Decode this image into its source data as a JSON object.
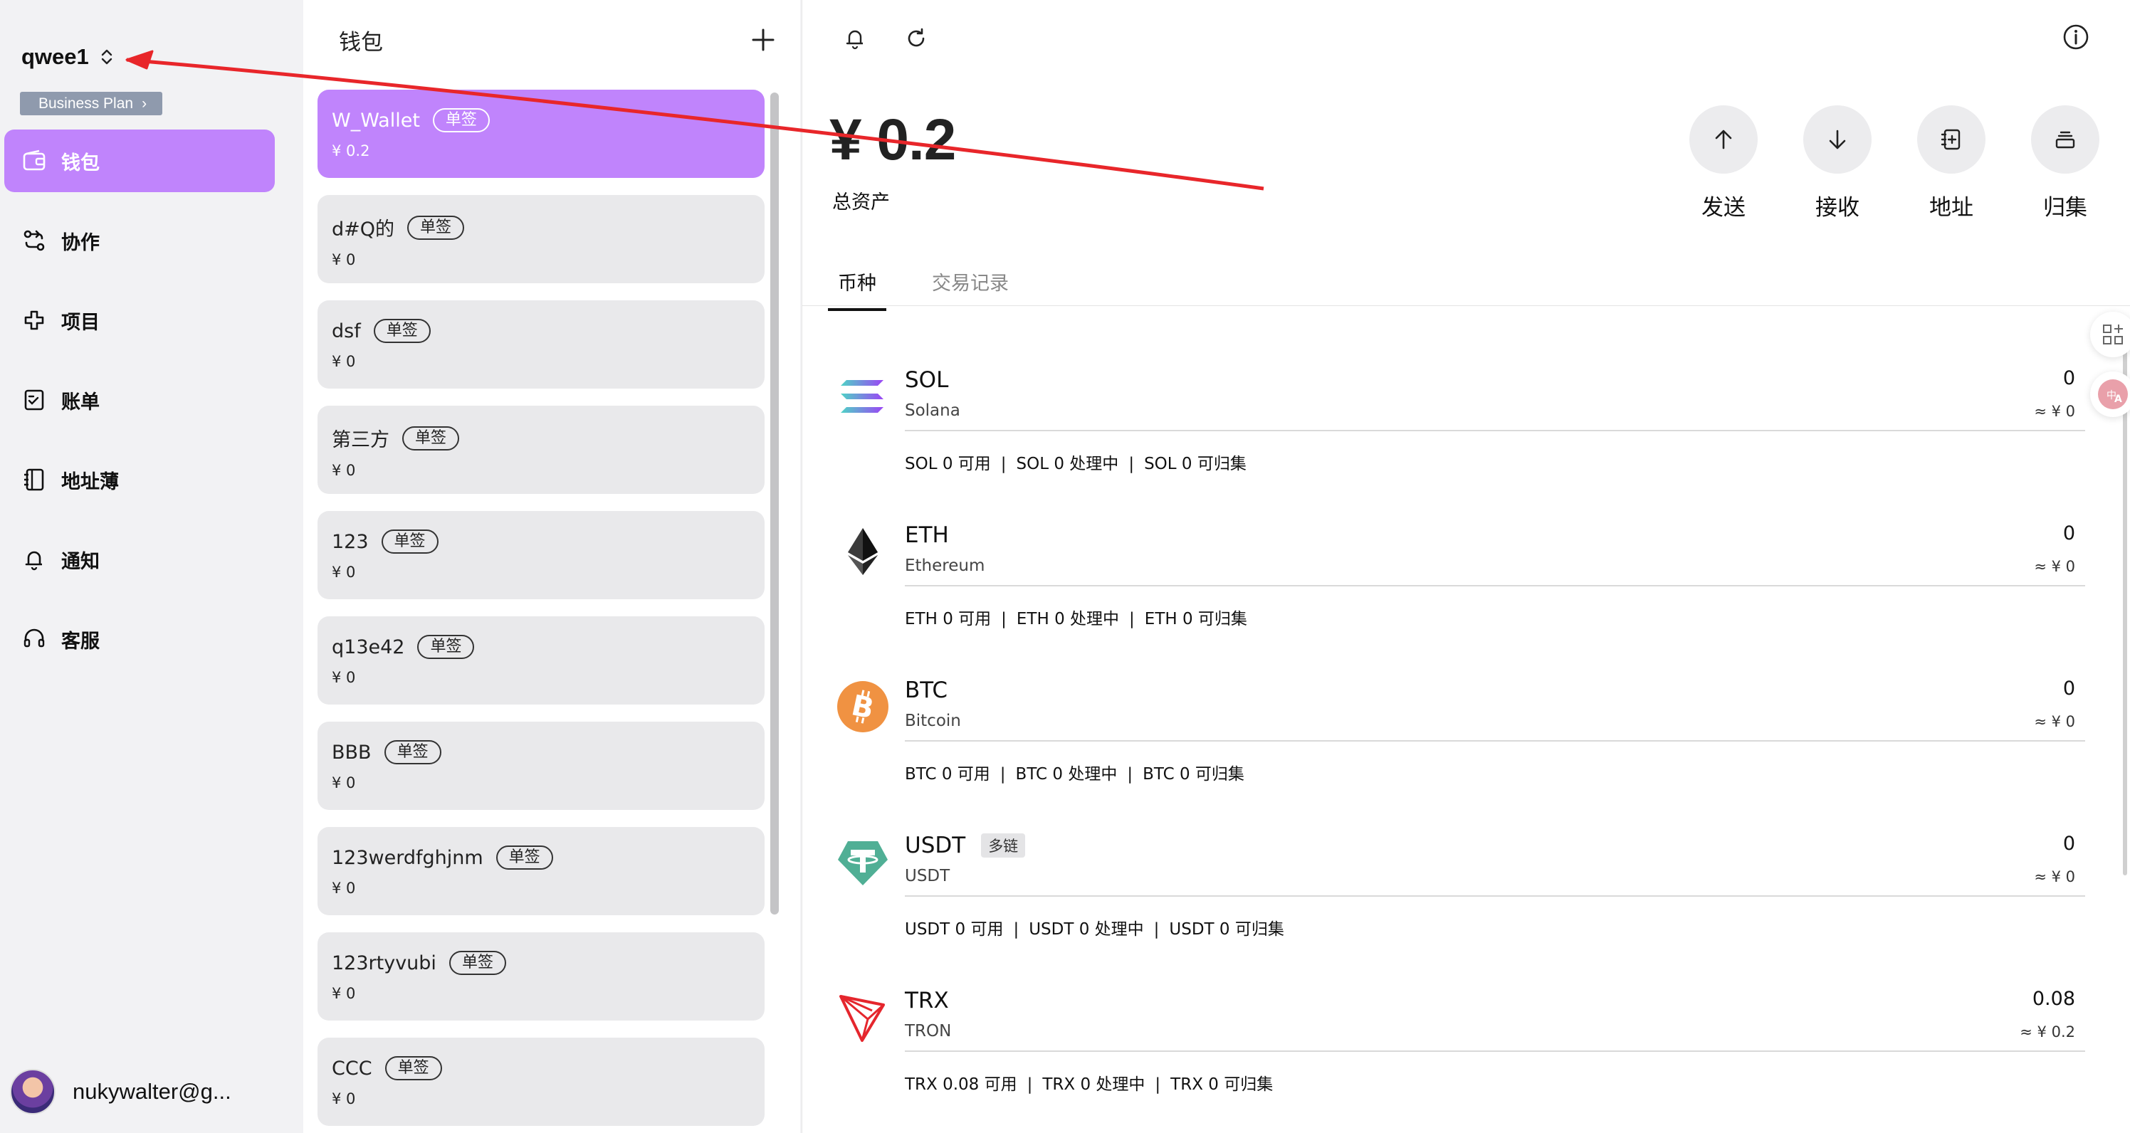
{
  "sidebar": {
    "workspace_name": "qwee1",
    "plan_label": "Business Plan",
    "plan_chevron": "›",
    "items": [
      {
        "label": "钱包",
        "icon": "wallet-icon",
        "active": true
      },
      {
        "label": "协作",
        "icon": "collaboration-icon"
      },
      {
        "label": "项目",
        "icon": "project-icon"
      },
      {
        "label": "账单",
        "icon": "bill-icon"
      },
      {
        "label": "地址薄",
        "icon": "address-book-icon"
      },
      {
        "label": "通知",
        "icon": "bell-icon"
      },
      {
        "label": "客服",
        "icon": "headset-icon"
      }
    ],
    "user_name": "nukywalter@g..."
  },
  "wallets": {
    "title": "钱包",
    "list": [
      {
        "name": "W_Wallet",
        "tag": "单签",
        "balance": "¥ 0.2"
      },
      {
        "name": "d#Q的",
        "tag": "单签",
        "balance": "¥ 0"
      },
      {
        "name": "dsf",
        "tag": "单签",
        "balance": "¥ 0"
      },
      {
        "name": "第三方",
        "tag": "单签",
        "balance": "¥ 0"
      },
      {
        "name": "123",
        "tag": "单签",
        "balance": "¥ 0"
      },
      {
        "name": "q13e42",
        "tag": "单签",
        "balance": "¥ 0"
      },
      {
        "name": "BBB",
        "tag": "单签",
        "balance": "¥ 0"
      },
      {
        "name": "123werdfghjnm",
        "tag": "单签",
        "balance": "¥ 0"
      },
      {
        "name": "123rtyvubi",
        "tag": "单签",
        "balance": "¥ 0"
      },
      {
        "name": "CCC",
        "tag": "单签",
        "balance": "¥ 0"
      }
    ]
  },
  "main": {
    "total": "¥ 0.2",
    "total_label": "总资产",
    "actions": [
      "发送",
      "接收",
      "地址",
      "归集"
    ],
    "tabs": [
      "币种",
      "交易记录"
    ],
    "coins": [
      {
        "symbol": "SOL",
        "name": "Solana",
        "amount": "0",
        "value": "≈ ¥ 0",
        "tag": "",
        "detail": [
          "SOL 0 可用",
          "SOL 0 处理中",
          "SOL 0 可归集"
        ]
      },
      {
        "symbol": "ETH",
        "name": "Ethereum",
        "amount": "0",
        "value": "≈ ¥ 0",
        "tag": "",
        "detail": [
          "ETH 0 可用",
          "ETH 0 处理中",
          "ETH 0 可归集"
        ]
      },
      {
        "symbol": "BTC",
        "name": "Bitcoin",
        "amount": "0",
        "value": "≈ ¥ 0",
        "tag": "",
        "detail": [
          "BTC 0 可用",
          "BTC 0 处理中",
          "BTC 0 可归集"
        ]
      },
      {
        "symbol": "USDT",
        "name": "USDT",
        "amount": "0",
        "value": "≈ ¥ 0",
        "tag": "多链",
        "detail": [
          "USDT 0 可用",
          "USDT 0 处理中",
          "USDT 0 可归集"
        ]
      },
      {
        "symbol": "TRX",
        "name": "TRON",
        "amount": "0.08",
        "value": "≈ ¥ 0.2",
        "tag": "",
        "detail": [
          "TRX 0.08 可用",
          "TRX 0 处理中",
          "TRX 0 可归集"
        ]
      }
    ],
    "separator": "|"
  },
  "colors": {
    "accent": "#c084fc",
    "annotation": "#e8262a",
    "btc": "#f09242",
    "usdt": "#50af95",
    "trx": "#e5262d"
  }
}
